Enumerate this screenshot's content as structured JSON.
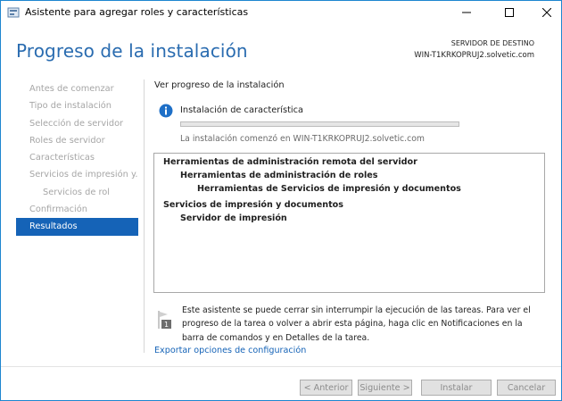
{
  "window": {
    "title": "Asistente para agregar roles y características"
  },
  "header": {
    "page_title": "Progreso de la instalación",
    "server_label": "SERVIDOR DE DESTINO",
    "server_name": "WIN-T1KRKOPRUJ2.solvetic.com"
  },
  "sidebar": {
    "items": [
      {
        "label": "Antes de comenzar"
      },
      {
        "label": "Tipo de instalación"
      },
      {
        "label": "Selección de servidor"
      },
      {
        "label": "Roles de servidor"
      },
      {
        "label": "Características"
      },
      {
        "label": "Servicios de impresión y..."
      },
      {
        "label": "Servicios de rol"
      },
      {
        "label": "Confirmación"
      },
      {
        "label": "Resultados"
      }
    ]
  },
  "main": {
    "section_title": "Ver progreso de la instalación",
    "status_title": "Instalación de característica",
    "progress_fraction": 0,
    "install_started": "La instalación comenzó en WIN-T1KRKOPRUJ2.solvetic.com",
    "results": [
      "Herramientas de administración remota del servidor",
      "Herramientas de administración de roles",
      "Herramientas de Servicios de impresión y documentos",
      "Servicios de impresión y documentos",
      "Servidor de impresión"
    ],
    "notice": "Este asistente se puede cerrar sin interrumpir la ejecución de las tareas. Para ver el progreso de la tarea o volver a abrir esta página, haga clic en Notificaciones en la barra de comandos y en Detalles de la tarea.",
    "notice_badge": "1",
    "export_link": "Exportar opciones de configuración"
  },
  "footer": {
    "prev": "< Anterior",
    "next": "Siguiente >",
    "install": "Instalar",
    "cancel": "Cancelar"
  },
  "colors": {
    "accent": "#1563b7",
    "title_blue": "#2a6cb0",
    "info_icon": "#1e6fc7"
  }
}
